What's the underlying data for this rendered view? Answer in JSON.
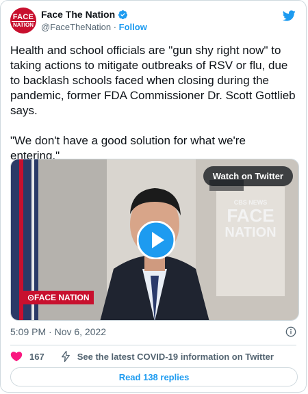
{
  "account": {
    "avatar_text_top": "FACE",
    "avatar_text_bottom": "NATION",
    "name": "Face The Nation",
    "handle": "@FaceTheNation",
    "separator": "·",
    "follow_label": "Follow"
  },
  "tweet": {
    "text": "Health and school officials are \"gun shy right now\" to taking actions to mitigate outbreaks of RSV or flu, due to backlash schools faced when closing during the pandemic, former FDA Commissioner Dr. Scott Gottlieb says.\n\n\"We don't have a good solution for what we're entering.\"",
    "timestamp": "5:09 PM · Nov 6, 2022"
  },
  "media": {
    "watch_label": "Watch on Twitter",
    "bug_text": "⊙FACE NATION",
    "screen_text_top": "CBS NEWS",
    "screen_text_face": "FACE",
    "screen_text_nation": "NATION"
  },
  "actions": {
    "like_count": "167",
    "covid_label": "See the latest COVID-19 information on Twitter",
    "replies_label": "Read 138 replies"
  },
  "colors": {
    "brand_blue": "#1d9bf0",
    "heart_red": "#f91880",
    "cbs_red": "#c8102e"
  }
}
